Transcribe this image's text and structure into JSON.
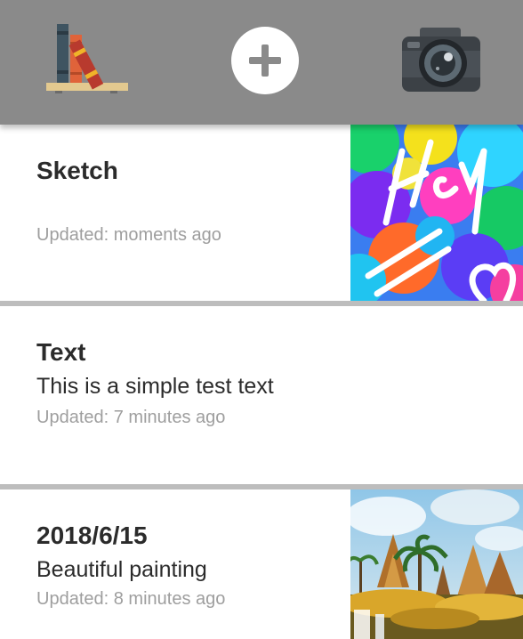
{
  "toolbar": {
    "library_icon": "bookshelf-icon",
    "add_icon": "plus-circle-icon",
    "camera_icon": "camera-icon"
  },
  "notes": [
    {
      "title": "Sketch",
      "body": "",
      "updated": "Updated: moments ago",
      "thumbnail": "sketch-hey-image"
    },
    {
      "title": "Text",
      "body": "This is a simple test text",
      "updated": "Updated: 7 minutes ago",
      "thumbnail": ""
    },
    {
      "title": "2018/6/15",
      "body": "Beautiful painting",
      "updated": "Updated: 8 minutes ago",
      "thumbnail": "fantasy-painting-image"
    }
  ]
}
